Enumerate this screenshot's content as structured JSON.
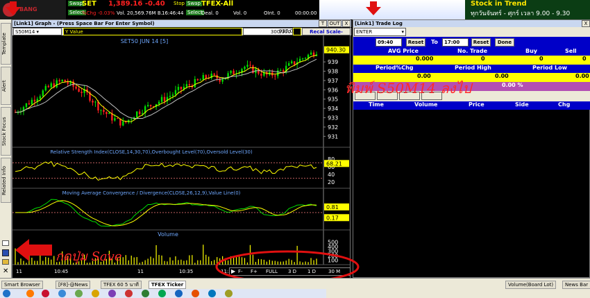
{
  "ticker": {
    "swap1": "Swap",
    "select1": "Select",
    "symbol1": "SET",
    "price1": "1,389.16 -0.40",
    "pct1": "%Chg -0.03%",
    "vol1": "Vol. 20,569.76M B.",
    "time1": "16:46:44",
    "stop": "Stop",
    "swap2": "Swap",
    "select2": "Select",
    "symbol2": "TFEX-All",
    "deal": "Deal. 0",
    "vol2": "Vol. 0",
    "oint": "OInt. 0",
    "time2": "00:00:00"
  },
  "banner": {
    "line1": "Stock in Trend",
    "line2": "ทุกวันจันทร์ - ศุกร์ เวลา 9.00 - 9.30"
  },
  "side_tabs": [
    "Template",
    "Alert",
    "Stock Focus",
    "Related Info"
  ],
  "graph": {
    "title": "[Link1] Graph - (Press Space Bar For Enter Symbol)",
    "btn_t": "T",
    "btn_out": "OUT",
    "btn_x": "X",
    "symbol": "S50M14",
    "field": "Y Value",
    "count": "300/300",
    "last": "937.03",
    "scale_btn": "Recal Scale-Linear",
    "price_title": "SET50 JUN 14   [5]",
    "price_tag": "940.30",
    "price_ticks": [
      "939",
      "938",
      "937",
      "936",
      "935",
      "934",
      "933",
      "932",
      "931"
    ],
    "rsi_title": "Relative Strength Index(CLOSE,14,30,70),Overbought Level(70),Oversold Level(30)",
    "rsi_ticks": [
      "80",
      "60",
      "40",
      "20"
    ],
    "rsi_tag": "68.21",
    "macd_title": "Moving Average Convergence / Divergence(CLOSE,26,12,9),Value Line(0)",
    "macd_tag1": "0.81",
    "macd_tag2": "0.17",
    "vol_title": "Volume",
    "vol_ticks": [
      "500",
      "400",
      "300",
      "200",
      "100"
    ],
    "time_labels": [
      "11",
      "10:45",
      "11",
      "10:35",
      "11:35",
      "15:35",
      "16:35"
    ],
    "nav": [
      "F-",
      "F+",
      "FULL",
      "3 D",
      "1 D",
      "30 M"
    ]
  },
  "trade": {
    "title": "[Link1] Trade Log",
    "enter": "ENTER",
    "from_time": "09:40",
    "reset1": "Reset",
    "to": "To",
    "to_time": "17:00",
    "reset2": "Reset",
    "done": "Done",
    "row1": [
      "AVG Price",
      "No. Trade",
      "Buy",
      "Sell"
    ],
    "row1_vals": [
      "0.000",
      "0",
      "0",
      "0"
    ],
    "row2": [
      "Period%Chg",
      "Period High",
      "Period Low"
    ],
    "row2_vals": [
      "0.00",
      "0.00",
      "0.00"
    ],
    "pct": "0.00 %",
    "cols": [
      "Time",
      "Volume",
      "Price",
      "Side",
      "Chg"
    ],
    "annotation": "พิมพ์ S50M14 ลงไป"
  },
  "annotation_save": "กดปุ่ม Save",
  "taskbar": {
    "items": [
      "Smart Browser",
      "[F8]-@News",
      "TFEX 60 5 นาที",
      "TFEX Ticker"
    ],
    "right": [
      "Volume(Board Lot)",
      "News Bar"
    ]
  },
  "colors": {
    "up": "#00e000",
    "down": "#ff2020",
    "ma": "#ffff00",
    "title_blue": "#0000c8"
  },
  "chart_data": {
    "type": "candlestick",
    "title": "SET50 JUN 14   [5]",
    "ylim": [
      930.5,
      940.5
    ],
    "last_price": 940.3,
    "rsi_last": 68.21,
    "macd_last": [
      0.81,
      0.17
    ]
  }
}
